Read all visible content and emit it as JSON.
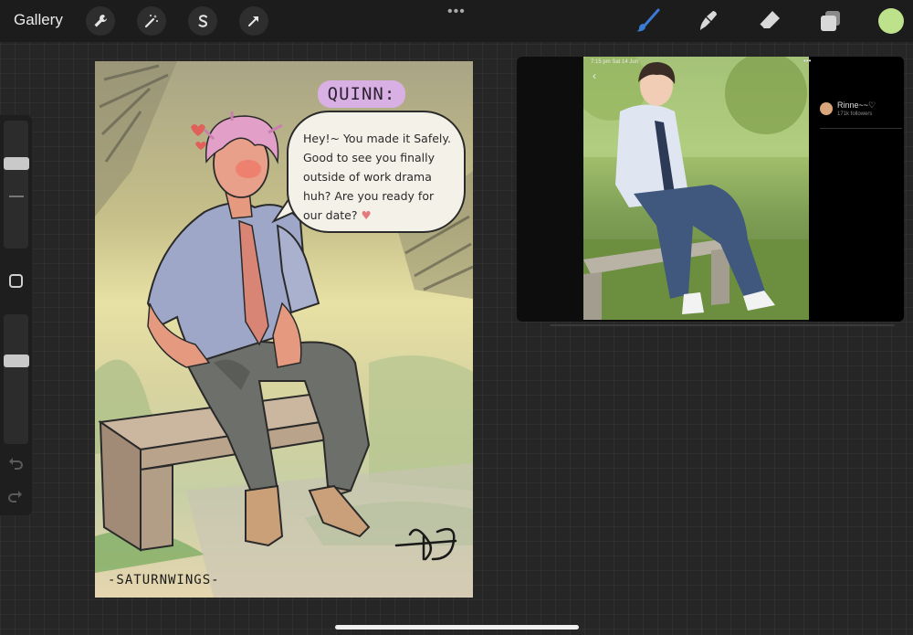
{
  "topbar": {
    "gallery_label": "Gallery",
    "more_dots": "•••",
    "tools": [
      "wrench-icon",
      "magic-wand-icon",
      "selection-s-icon",
      "transform-arrow-icon"
    ],
    "right_tools": [
      "brush-icon",
      "smudge-icon",
      "eraser-icon",
      "layers-icon"
    ],
    "active_tool": "brush-icon",
    "accent_color": "#3b7bd4",
    "current_color": "#bde28b"
  },
  "canvas": {
    "name_tag": "QUINN:",
    "speech_lines": [
      "Hey!~ You made it Safely.",
      "Good to see you finally",
      "outside of work drama",
      "huh? Are you ready for",
      "our date?"
    ],
    "signature": "-SATURNWINGS-",
    "initials": "RD"
  },
  "reference": {
    "status_time": "7:15 pm  Sat 14 Jun",
    "menu": "•••",
    "username": "Rinne~~♡",
    "followers": "171k followers"
  }
}
